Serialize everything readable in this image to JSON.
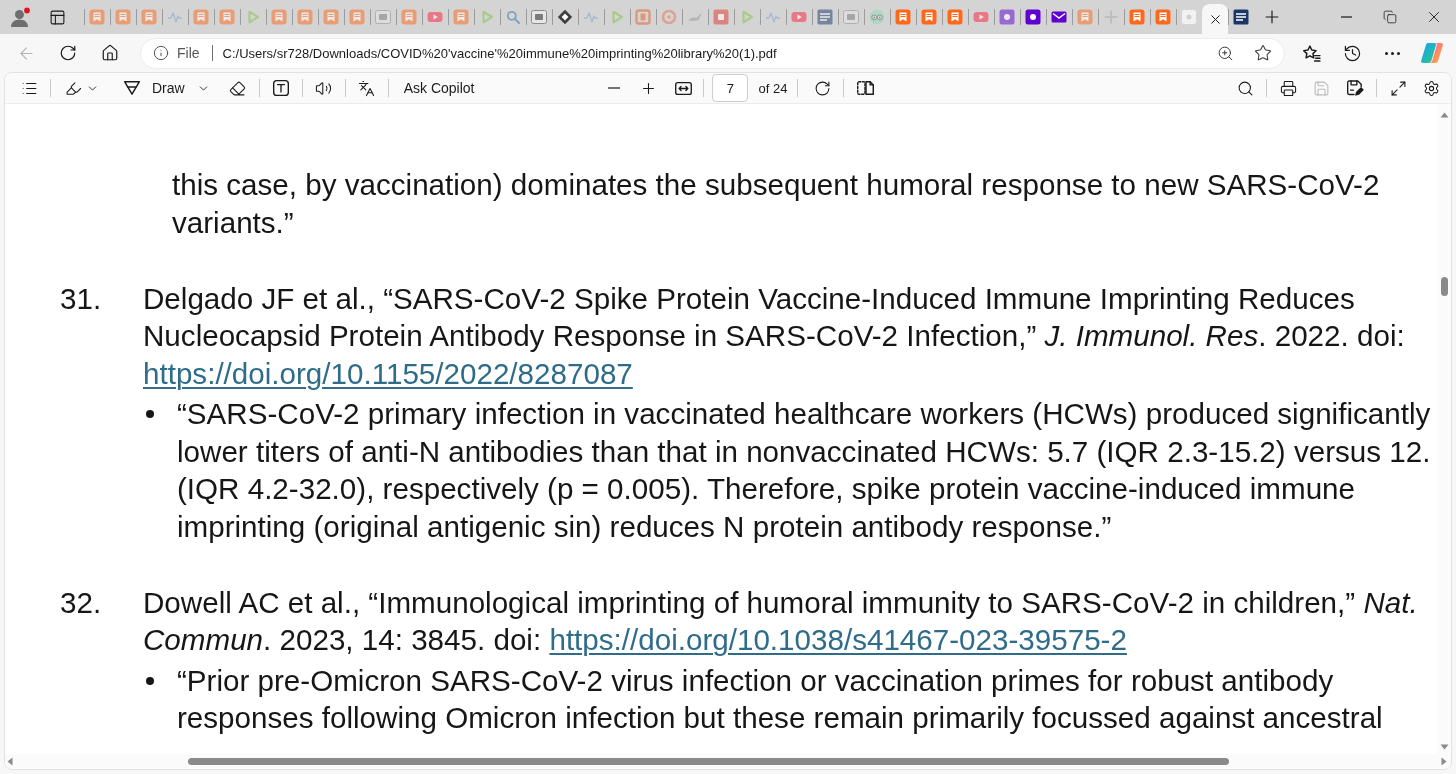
{
  "browser": {
    "tabs": [
      {
        "kind": "bookmark",
        "sleeping": true,
        "selected": false
      },
      {
        "kind": "bookmark",
        "sleeping": true,
        "selected": false
      },
      {
        "kind": "bookmark",
        "sleeping": true,
        "selected": false
      },
      {
        "kind": "wave",
        "sleeping": true,
        "selected": false
      },
      {
        "kind": "bookmark",
        "sleeping": true,
        "selected": false
      },
      {
        "kind": "bookmark",
        "sleeping": true,
        "selected": false
      },
      {
        "kind": "play",
        "sleeping": true,
        "selected": false
      },
      {
        "kind": "bookmark",
        "sleeping": true,
        "selected": false
      },
      {
        "kind": "bookmark",
        "sleeping": true,
        "selected": false
      },
      {
        "kind": "bookmark",
        "sleeping": true,
        "selected": false
      },
      {
        "kind": "bookmark",
        "sleeping": true,
        "selected": false
      },
      {
        "kind": "monogram",
        "sleeping": true,
        "selected": false
      },
      {
        "kind": "bookmark",
        "sleeping": true,
        "selected": false
      },
      {
        "kind": "video",
        "sleeping": true,
        "selected": false
      },
      {
        "kind": "bookmark",
        "sleeping": true,
        "selected": false
      },
      {
        "kind": "play",
        "sleeping": true,
        "selected": false
      },
      {
        "kind": "search",
        "sleeping": true,
        "selected": false
      },
      {
        "kind": "monogram",
        "sleeping": false,
        "selected": false
      },
      {
        "kind": "diamond",
        "sleeping": false,
        "selected": false
      },
      {
        "kind": "wave",
        "sleeping": true,
        "selected": false
      },
      {
        "kind": "play",
        "sleeping": true,
        "selected": false
      },
      {
        "kind": "frame",
        "sleeping": true,
        "selected": false
      },
      {
        "kind": "ring",
        "sleeping": true,
        "selected": false
      },
      {
        "kind": "bird",
        "sleeping": true,
        "selected": false
      },
      {
        "kind": "square",
        "sleeping": true,
        "selected": false
      },
      {
        "kind": "play",
        "sleeping": true,
        "selected": false
      },
      {
        "kind": "wave",
        "sleeping": true,
        "selected": false
      },
      {
        "kind": "video",
        "sleeping": true,
        "selected": false
      },
      {
        "kind": "news",
        "sleeping": true,
        "selected": false
      },
      {
        "kind": "monogram",
        "sleeping": true,
        "selected": false
      },
      {
        "kind": "owl",
        "sleeping": true,
        "selected": false
      },
      {
        "kind": "bookmark",
        "sleeping": false,
        "selected": false
      },
      {
        "kind": "bookmark",
        "sleeping": false,
        "selected": false
      },
      {
        "kind": "bookmark",
        "sleeping": false,
        "selected": false
      },
      {
        "kind": "video",
        "sleeping": true,
        "selected": false
      },
      {
        "kind": "purple",
        "sleeping": true,
        "selected": false
      },
      {
        "kind": "purple",
        "sleeping": false,
        "selected": false
      },
      {
        "kind": "mail",
        "sleeping": false,
        "selected": false
      },
      {
        "kind": "bookmark",
        "sleeping": true,
        "selected": false
      },
      {
        "kind": "cross",
        "sleeping": true,
        "selected": false
      },
      {
        "kind": "bookmark",
        "sleeping": false,
        "selected": false
      },
      {
        "kind": "bookmark",
        "sleeping": false,
        "selected": false
      },
      {
        "kind": "light",
        "sleeping": false,
        "selected": false
      },
      {
        "sleeping": false,
        "selected": true
      },
      {
        "kind": "news",
        "sleeping": false,
        "selected": false
      }
    ],
    "back_disabled": true,
    "address": {
      "scheme_label": "File",
      "url": "C:/Users/sr728/Downloads/COVID%20'vaccine'%20immune%20imprinting%20library%20(1).pdf"
    }
  },
  "pdf_toolbar": {
    "draw_label": "Draw",
    "copilot_label": "Ask Copilot",
    "page_number": "7",
    "page_count": "of 24",
    "save_disabled": true
  },
  "document": {
    "continued_quote": [
      "this case, by vaccination) dominates the subsequent humoral response to new SARS-CoV-2",
      "variants.”"
    ],
    "references": [
      {
        "number": "31.",
        "citation_lines": [
          {
            "text": "Delgado JF et al., “SARS-CoV-2 Spike Protein Vaccine-Induced Immune Imprinting Reduces"
          },
          {
            "text": "Nucleocapsid Protein Antibody Response in SARS-CoV-2 Infection,” *J. Immunol. Res*. 2022. doi:"
          },
          {
            "link": "https://doi.org/10.1155/2022/8287087"
          }
        ],
        "quotes": [
          {
            "lines": [
              "“SARS-CoV-2 primary infection in vaccinated healthcare workers (HCWs) produced significantly",
              "lower titers of anti-N antibodies than that in nonvaccinated HCWs: 5.7 (IQR 2.3-15.2) versus 12.",
              "(IQR 4.2-32.0), respectively (p = 0.005). Therefore, spike protein vaccine-induced immune",
              "imprinting (original antigenic sin) reduces N protein antibody response.”"
            ]
          }
        ]
      },
      {
        "number": "32.",
        "citation_lines": [
          {
            "text": "Dowell AC et al., “Immunological imprinting of humoral immunity to SARS-CoV-2 in children,” *Nat.*"
          },
          {
            "text": "*Commun*. 2023, 14: 3845. doi:",
            "link": "https://doi.org/10.1038/s41467-023-39575-2"
          }
        ],
        "quotes": [
          {
            "lines": [
              "“Prior pre-Omicron SARS-CoV-2 virus infection or vaccination primes for robust antibody",
              "responses following Omicron infection but these remain primarily focussed against ancestral"
            ]
          }
        ]
      }
    ]
  }
}
